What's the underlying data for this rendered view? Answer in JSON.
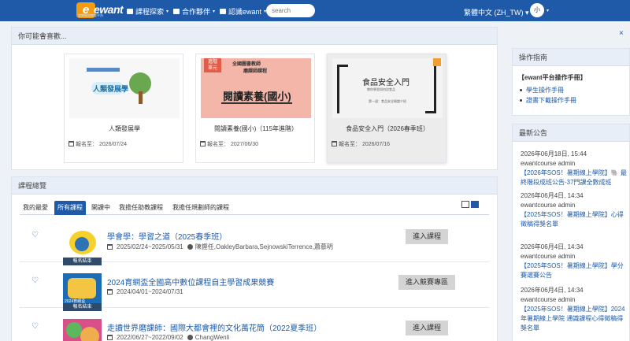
{
  "nav": {
    "logo_text": "ewant",
    "logo_sub": "育網開放教育平台",
    "items": [
      {
        "label": "課程探索",
        "icon": "book-icon"
      },
      {
        "label": "合作夥伴",
        "icon": "briefcase-icon"
      },
      {
        "label": "認識ewant",
        "icon": "info-icon"
      }
    ],
    "search_placeholder": "search",
    "language": "繁體中文 (ZH_TW) ▾",
    "user_initial": "小"
  },
  "recommend": {
    "heading": "你可能會喜歡...",
    "cards": [
      {
        "title": "人類發展學",
        "date": "報名至： 2026/07/24",
        "thumb_text": "人類發展學"
      },
      {
        "title": "閱讀素養(國小)（115年進階）",
        "date": "報名至： 2027/06/30",
        "thumb_badge": "進階\n單元",
        "thumb_line1": "全國圖書教師",
        "thumb_line2": "磨課師課程",
        "thumb_big": "閱讀素養(國小)"
      },
      {
        "title": "食品安全入門（2026春季班）",
        "date": "報名至： 2026/07/16",
        "thumb_title": "食品安全入門",
        "thumb_sub": "教你學習如何對食品",
        "thumb_sub2": "第一週：食品安全概論介紹"
      }
    ]
  },
  "overview": {
    "heading": "課程總覽",
    "tabs": [
      "我的最愛",
      "所有課程",
      "開課中",
      "我擔任助教課程",
      "我擔任規劃師的課程"
    ],
    "courses": [
      {
        "title": "學會學：學習之道（2025春季班）",
        "dates": "2025/02/24~2025/05/31",
        "teachers": "陳鏗任,OakleyBarbara,SejnowskiTerrence,蕭慕明",
        "button": "進入課程",
        "thumb_caption": "報名結束"
      },
      {
        "title": "2024育網盃全國高中數位課程自主學習成果競賽",
        "dates": "2024/04/01~2024/07/31",
        "teachers": "",
        "button": "進入競賽專區",
        "thumb_caption": "報名結束",
        "thumb_text": "2024育網盃"
      },
      {
        "title": "走讀世界磨課師：國際大都會裡的文化萬花筒（2022夏季班）",
        "dates": "2022/06/27~2022/09/02",
        "teachers": "ChangWenli",
        "button": "進入課程",
        "thumb_caption": ""
      }
    ]
  },
  "sidebar": {
    "close": "×",
    "guide": {
      "heading": "操作指南",
      "section": "【ewant平台操作手冊】",
      "links": [
        "學生操作手冊",
        "證書下載操作手冊"
      ]
    },
    "news": {
      "heading": "最新公告",
      "items": [
        {
          "time": "2026年06月18日, 15:44",
          "author": "ewantcourse admin",
          "title": "【2026年SOS！暑期線上學院】🐘 最終階段成班公告-37門課全數成班"
        },
        {
          "time": "2026年06月4日, 14:34",
          "author": "ewantcourse admin",
          "title": "【2025年SOS！暑期線上學院】心得徵稿得獎名單"
        },
        {
          "time": "2026年06月4日, 14:34",
          "author": "ewantcourse admin",
          "title": "【2025年SOS！暑期線上學院】學分賽選賽公告"
        },
        {
          "time": "2026年06月4日, 14:34",
          "author": "ewantcourse admin",
          "title": "【2025年SOS！暑期線上學院】2024年暑期線上學院 通識課程心得徵稿得獎名單"
        }
      ]
    }
  },
  "colors": {
    "brand": "#1e5aa8",
    "accent": "#f39c12",
    "panel_head": "#e8eef7"
  }
}
